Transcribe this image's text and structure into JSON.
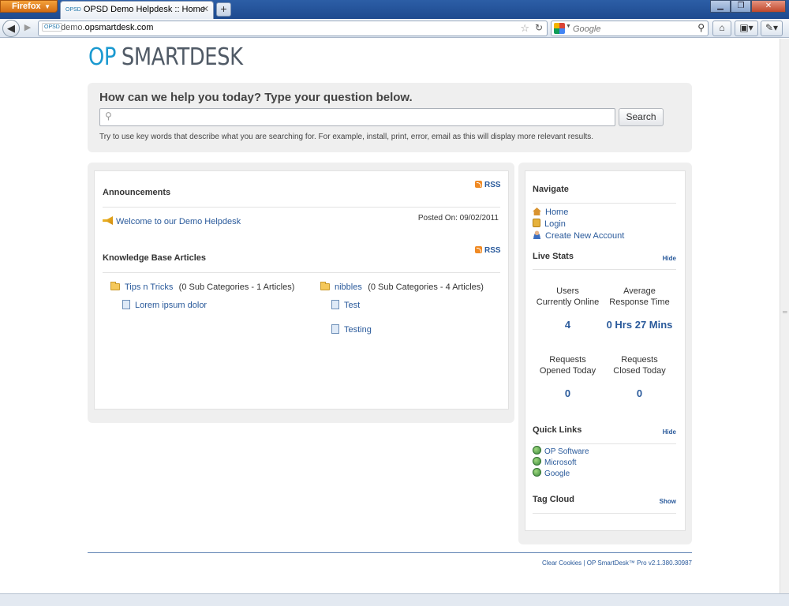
{
  "browser": {
    "menu_button": "Firefox",
    "tab_title": "OPSD Demo Helpdesk :: Home",
    "tab_favicon": "OPSD",
    "url_host_prefix": "demo.",
    "url_host_main": "opsmartdesk.com",
    "search_engine_placeholder": "Google"
  },
  "logo": {
    "part1": "OP",
    "part2": "SMARTDESK"
  },
  "search": {
    "heading": "How can we help you today? Type your question below.",
    "input_value": "",
    "button_label": "Search",
    "hint": "Try to use key words that describe what you are searching for. For example, install, print, error, email as this will display more relevant results."
  },
  "announcements": {
    "title": "Announcements",
    "rss_label": "RSS",
    "items": [
      {
        "title": "Welcome to our Demo Helpdesk",
        "posted": "Posted On: 09/02/2011"
      }
    ]
  },
  "knowledge_base": {
    "title": "Knowledge Base Articles",
    "rss_label": "RSS",
    "categories": [
      {
        "name": "Tips n Tricks",
        "meta": "(0 Sub Categories - 1 Articles)",
        "articles": [
          "Lorem ipsum dolor"
        ]
      },
      {
        "name": "nibbles",
        "meta": "(0 Sub Categories - 4 Articles)",
        "articles": [
          "Test",
          "Testing"
        ]
      }
    ]
  },
  "navigate": {
    "title": "Navigate",
    "links": [
      "Home",
      "Login",
      "Create New Account"
    ]
  },
  "live_stats": {
    "title": "Live Stats",
    "toggle": "Hide",
    "stats": [
      {
        "label1": "Users",
        "label2": "Currently Online",
        "value": "4"
      },
      {
        "label1": "Average",
        "label2": "Response Time",
        "value": "0 Hrs 27 Mins"
      },
      {
        "label1": "Requests",
        "label2": "Opened Today",
        "value": "0"
      },
      {
        "label1": "Requests",
        "label2": "Closed Today",
        "value": "0"
      }
    ]
  },
  "quick_links": {
    "title": "Quick Links",
    "toggle": "Hide",
    "links": [
      "OP Software",
      "Microsoft",
      "Google"
    ]
  },
  "tag_cloud": {
    "title": "Tag Cloud",
    "toggle": "Show"
  },
  "footer": {
    "clear_cookies": "Clear Cookies",
    "separator": "|",
    "version": "OP SmartDesk™ Pro v2.1.380.30987"
  }
}
